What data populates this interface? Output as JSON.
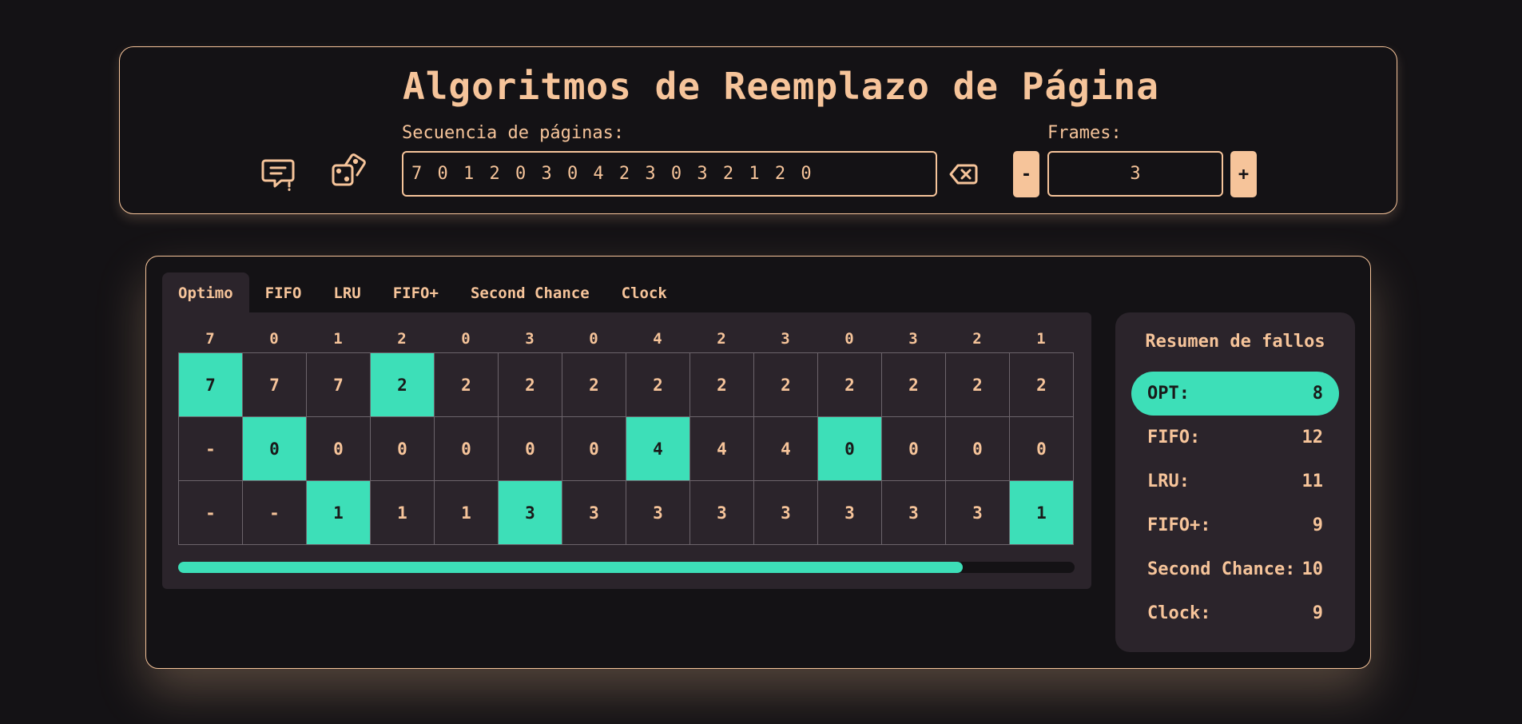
{
  "header": {
    "title": "Algoritmos de Reemplazo de Página",
    "sequence_label": "Secuencia de páginas:",
    "sequence_value": "7 0 1 2 0 3 0 4 2 3 0 3 2 1 2 0",
    "frames_label": "Frames:",
    "frames_value": "3",
    "decrement_label": "-",
    "increment_label": "+",
    "icons": [
      "message-alert-icon",
      "dice-icon",
      "backspace-clear-icon"
    ]
  },
  "tabs": [
    {
      "label": "Optimo",
      "active": true
    },
    {
      "label": "FIFO",
      "active": false
    },
    {
      "label": "LRU",
      "active": false
    },
    {
      "label": "FIFO+",
      "active": false
    },
    {
      "label": "Second Chance",
      "active": false
    },
    {
      "label": "Clock",
      "active": false
    }
  ],
  "references": [
    "7",
    "0",
    "1",
    "2",
    "0",
    "3",
    "0",
    "4",
    "2",
    "3",
    "0",
    "3",
    "2",
    "1"
  ],
  "frames": [
    [
      "7",
      "7",
      "7",
      "2",
      "2",
      "2",
      "2",
      "2",
      "2",
      "2",
      "2",
      "2",
      "2",
      "2"
    ],
    [
      "-",
      "0",
      "0",
      "0",
      "0",
      "0",
      "0",
      "4",
      "4",
      "4",
      "0",
      "0",
      "0",
      "0"
    ],
    [
      "-",
      "-",
      "1",
      "1",
      "1",
      "3",
      "3",
      "3",
      "3",
      "3",
      "3",
      "3",
      "3",
      "1"
    ]
  ],
  "highlights": [
    [
      true,
      false,
      false,
      true,
      false,
      false,
      false,
      false,
      false,
      false,
      false,
      false,
      false,
      false
    ],
    [
      false,
      true,
      false,
      false,
      false,
      false,
      false,
      true,
      false,
      false,
      true,
      false,
      false,
      false
    ],
    [
      false,
      false,
      true,
      false,
      false,
      true,
      false,
      false,
      false,
      false,
      false,
      false,
      false,
      true
    ]
  ],
  "progress": 0.875,
  "summary": {
    "title": "Resumen de fallos",
    "items": [
      {
        "label": "OPT:",
        "count": "8",
        "active": true
      },
      {
        "label": "FIFO:",
        "count": "12",
        "active": false
      },
      {
        "label": "LRU:",
        "count": "11",
        "active": false
      },
      {
        "label": "FIFO+:",
        "count": "9",
        "active": false
      },
      {
        "label": "Second Chance:",
        "count": "10",
        "active": false
      },
      {
        "label": "Clock:",
        "count": "9",
        "active": false
      }
    ]
  },
  "colors": {
    "accent": "#f6c49a",
    "hit": "#3ddfb8",
    "background": "#141215",
    "panel": "#2b242b"
  }
}
